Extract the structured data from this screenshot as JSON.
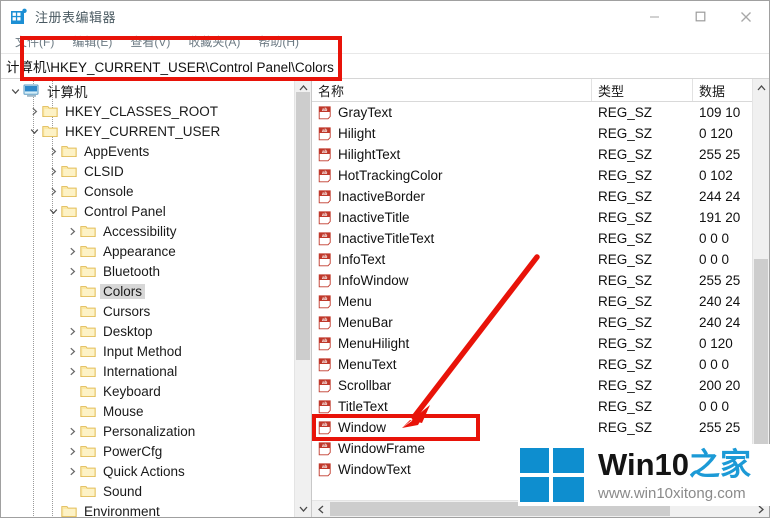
{
  "window": {
    "title": "注册表编辑器",
    "app_icon": "registry-editor-icon",
    "caption": {
      "minimize": "minimize-icon",
      "maximize": "maximize-icon",
      "close": "close-icon"
    }
  },
  "menubar": {
    "items": [
      {
        "label": "文件(F)"
      },
      {
        "label": "编辑(E)"
      },
      {
        "label": "查看(V)"
      },
      {
        "label": "收藏夹(A)"
      },
      {
        "label": "帮助(H)"
      }
    ]
  },
  "address": {
    "path": "计算机\\HKEY_CURRENT_USER\\Control Panel\\Colors"
  },
  "tree": {
    "items": [
      {
        "label": "计算机",
        "depth": 0,
        "expander": "expanded",
        "icon": "computer-icon",
        "selected": false
      },
      {
        "label": "HKEY_CLASSES_ROOT",
        "depth": 1,
        "expander": "collapsed",
        "icon": "folder-icon",
        "selected": false
      },
      {
        "label": "HKEY_CURRENT_USER",
        "depth": 1,
        "expander": "expanded",
        "icon": "folder-icon",
        "selected": false
      },
      {
        "label": "AppEvents",
        "depth": 2,
        "expander": "collapsed",
        "icon": "folder-icon",
        "selected": false
      },
      {
        "label": "CLSID",
        "depth": 2,
        "expander": "collapsed",
        "icon": "folder-icon",
        "selected": false
      },
      {
        "label": "Console",
        "depth": 2,
        "expander": "collapsed",
        "icon": "folder-icon",
        "selected": false
      },
      {
        "label": "Control Panel",
        "depth": 2,
        "expander": "expanded",
        "icon": "folder-icon",
        "selected": false
      },
      {
        "label": "Accessibility",
        "depth": 3,
        "expander": "collapsed",
        "icon": "folder-icon",
        "selected": false
      },
      {
        "label": "Appearance",
        "depth": 3,
        "expander": "collapsed",
        "icon": "folder-icon",
        "selected": false
      },
      {
        "label": "Bluetooth",
        "depth": 3,
        "expander": "collapsed",
        "icon": "folder-icon",
        "selected": false
      },
      {
        "label": "Colors",
        "depth": 3,
        "expander": "none",
        "icon": "folder-icon",
        "selected": true
      },
      {
        "label": "Cursors",
        "depth": 3,
        "expander": "none",
        "icon": "folder-icon",
        "selected": false
      },
      {
        "label": "Desktop",
        "depth": 3,
        "expander": "collapsed",
        "icon": "folder-icon",
        "selected": false
      },
      {
        "label": "Input Method",
        "depth": 3,
        "expander": "collapsed",
        "icon": "folder-icon",
        "selected": false
      },
      {
        "label": "International",
        "depth": 3,
        "expander": "collapsed",
        "icon": "folder-icon",
        "selected": false
      },
      {
        "label": "Keyboard",
        "depth": 3,
        "expander": "none",
        "icon": "folder-icon",
        "selected": false
      },
      {
        "label": "Mouse",
        "depth": 3,
        "expander": "none",
        "icon": "folder-icon",
        "selected": false
      },
      {
        "label": "Personalization",
        "depth": 3,
        "expander": "collapsed",
        "icon": "folder-icon",
        "selected": false
      },
      {
        "label": "PowerCfg",
        "depth": 3,
        "expander": "collapsed",
        "icon": "folder-icon",
        "selected": false
      },
      {
        "label": "Quick Actions",
        "depth": 3,
        "expander": "collapsed",
        "icon": "folder-icon",
        "selected": false
      },
      {
        "label": "Sound",
        "depth": 3,
        "expander": "none",
        "icon": "folder-icon",
        "selected": false
      },
      {
        "label": "Environment",
        "depth": 2,
        "expander": "none",
        "icon": "folder-icon",
        "selected": false
      }
    ]
  },
  "values": {
    "columns": [
      {
        "label": "名称"
      },
      {
        "label": "类型"
      },
      {
        "label": "数据"
      }
    ],
    "rows": [
      {
        "name": "GrayText",
        "type": "REG_SZ",
        "data": "109 10",
        "icon": "string-value-icon"
      },
      {
        "name": "Hilight",
        "type": "REG_SZ",
        "data": "0 120",
        "icon": "string-value-icon"
      },
      {
        "name": "HilightText",
        "type": "REG_SZ",
        "data": "255 25",
        "icon": "string-value-icon"
      },
      {
        "name": "HotTrackingColor",
        "type": "REG_SZ",
        "data": "0 102",
        "icon": "string-value-icon"
      },
      {
        "name": "InactiveBorder",
        "type": "REG_SZ",
        "data": "244 24",
        "icon": "string-value-icon"
      },
      {
        "name": "InactiveTitle",
        "type": "REG_SZ",
        "data": "191 20",
        "icon": "string-value-icon"
      },
      {
        "name": "InactiveTitleText",
        "type": "REG_SZ",
        "data": "0 0 0",
        "icon": "string-value-icon"
      },
      {
        "name": "InfoText",
        "type": "REG_SZ",
        "data": "0 0 0",
        "icon": "string-value-icon"
      },
      {
        "name": "InfoWindow",
        "type": "REG_SZ",
        "data": "255 25",
        "icon": "string-value-icon"
      },
      {
        "name": "Menu",
        "type": "REG_SZ",
        "data": "240 24",
        "icon": "string-value-icon"
      },
      {
        "name": "MenuBar",
        "type": "REG_SZ",
        "data": "240 24",
        "icon": "string-value-icon"
      },
      {
        "name": "MenuHilight",
        "type": "REG_SZ",
        "data": "0 120",
        "icon": "string-value-icon"
      },
      {
        "name": "MenuText",
        "type": "REG_SZ",
        "data": "0 0 0",
        "icon": "string-value-icon"
      },
      {
        "name": "Scrollbar",
        "type": "REG_SZ",
        "data": "200 20",
        "icon": "string-value-icon"
      },
      {
        "name": "TitleText",
        "type": "REG_SZ",
        "data": "0 0 0",
        "icon": "string-value-icon"
      },
      {
        "name": "Window",
        "type": "REG_SZ",
        "data": "255 25",
        "icon": "string-value-icon"
      },
      {
        "name": "WindowFrame",
        "type": "",
        "data": "",
        "icon": "string-value-icon"
      },
      {
        "name": "WindowText",
        "type": "",
        "data": "",
        "icon": "string-value-icon"
      }
    ]
  },
  "annotations": {
    "accent_color": "#e81309",
    "address_highlight": "red-rectangle-address-bar",
    "window_highlight": "red-rectangle-window-value",
    "arrow": "red-arrow-pointing-to-window-value"
  },
  "watermark": {
    "brand_black": "Win10",
    "brand_blue": "之家",
    "url": "www.win10xitong.com",
    "logo": "windows-logo-icon",
    "logo_color": "#0e8ecf"
  }
}
